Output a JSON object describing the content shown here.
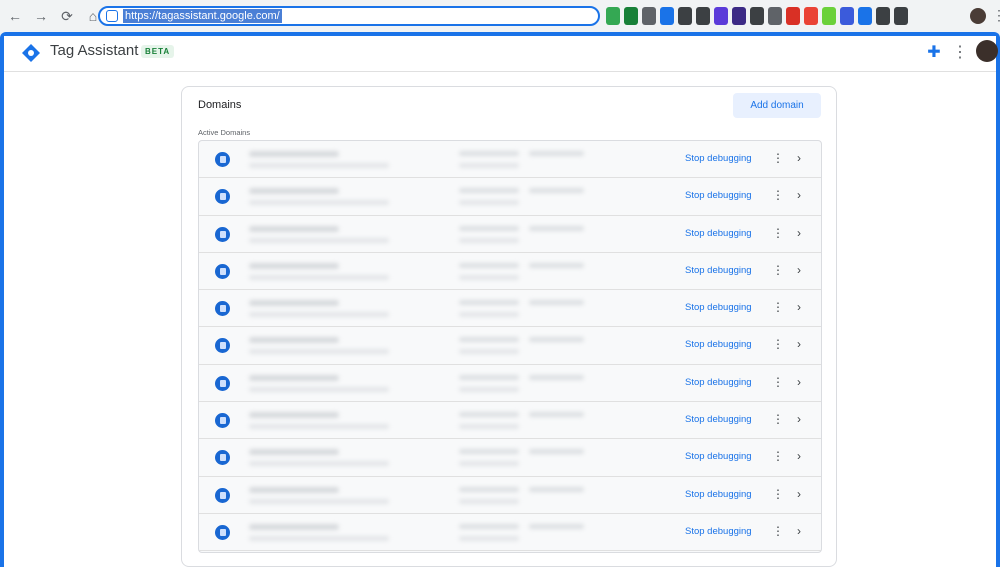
{
  "browser": {
    "url": "https://tagassistant.google.com/",
    "nav": {
      "back": "←",
      "forward": "→",
      "reload": "⟳",
      "home": "⌂"
    },
    "menu_glyph": "⋮",
    "extension_colors": [
      "#34a853",
      "#188038",
      "#5f6368",
      "#1a73e8",
      "#3c4043",
      "#3c4043",
      "#5b3bd9",
      "#3c2a85",
      "#3c4043",
      "#5f6368",
      "#d93025",
      "#ea4335",
      "#6bd13a",
      "#3b5bdb",
      "#1a73e8",
      "#3c4043",
      "#3c4043"
    ]
  },
  "app": {
    "title": "Tag Assistant",
    "badge": "BETA",
    "extension_icon": "puzzle-icon",
    "menu_glyph": "⋮",
    "accent": "#1a73e8"
  },
  "domains": {
    "title": "Domains",
    "add_label": "Add domain",
    "active_label": "Active Domains",
    "rows": [
      {
        "action": "Stop debugging"
      },
      {
        "action": "Stop debugging"
      },
      {
        "action": "Stop debugging"
      },
      {
        "action": "Stop debugging"
      },
      {
        "action": "Stop debugging"
      },
      {
        "action": "Stop debugging"
      },
      {
        "action": "Stop debugging"
      },
      {
        "action": "Stop debugging"
      },
      {
        "action": "Stop debugging"
      },
      {
        "action": "Stop debugging"
      },
      {
        "action": "Stop debugging"
      }
    ],
    "row_menu_glyph": "⋮",
    "row_chevron_glyph": "›"
  }
}
